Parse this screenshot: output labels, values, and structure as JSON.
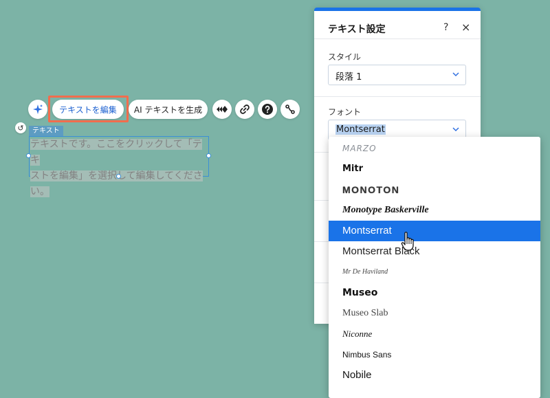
{
  "toolbar": {
    "edit_text_label": "テキストを編集",
    "ai_generate_label": "AI テキストを生成",
    "icons": [
      "ai-sparkle-icon",
      "animation-icon",
      "link-icon",
      "help-icon",
      "connect-icon"
    ]
  },
  "element": {
    "tag_label": "テキスト",
    "text_line1": "テキストです。ここをクリックして「テキ",
    "text_line2": "ストを編集」を選択して編集してくださ",
    "text_line3": "い。"
  },
  "panel": {
    "title": "テキスト設定",
    "help_label": "?",
    "close_label": "×",
    "style_label": "スタイル",
    "style_value": "段落 1",
    "font_label": "フォント",
    "font_value": "Montserrat"
  },
  "font_dropdown": {
    "options": [
      {
        "label": "MARZO"
      },
      {
        "label": "Mitr"
      },
      {
        "label": "MONOTON"
      },
      {
        "label": "Monotype Baskerville"
      },
      {
        "label": "Montserrat",
        "selected": true
      },
      {
        "label": "Montserrat Black"
      },
      {
        "label": "Mr De Haviland"
      },
      {
        "label": "Museo"
      },
      {
        "label": "Museo Slab"
      },
      {
        "label": "Niconne"
      },
      {
        "label": "Nimbus Sans"
      },
      {
        "label": "Nobile"
      }
    ]
  },
  "colors": {
    "canvas_bg": "#7cb3a6",
    "accent": "#1a73e8",
    "highlight_border": "#f26d4d"
  }
}
